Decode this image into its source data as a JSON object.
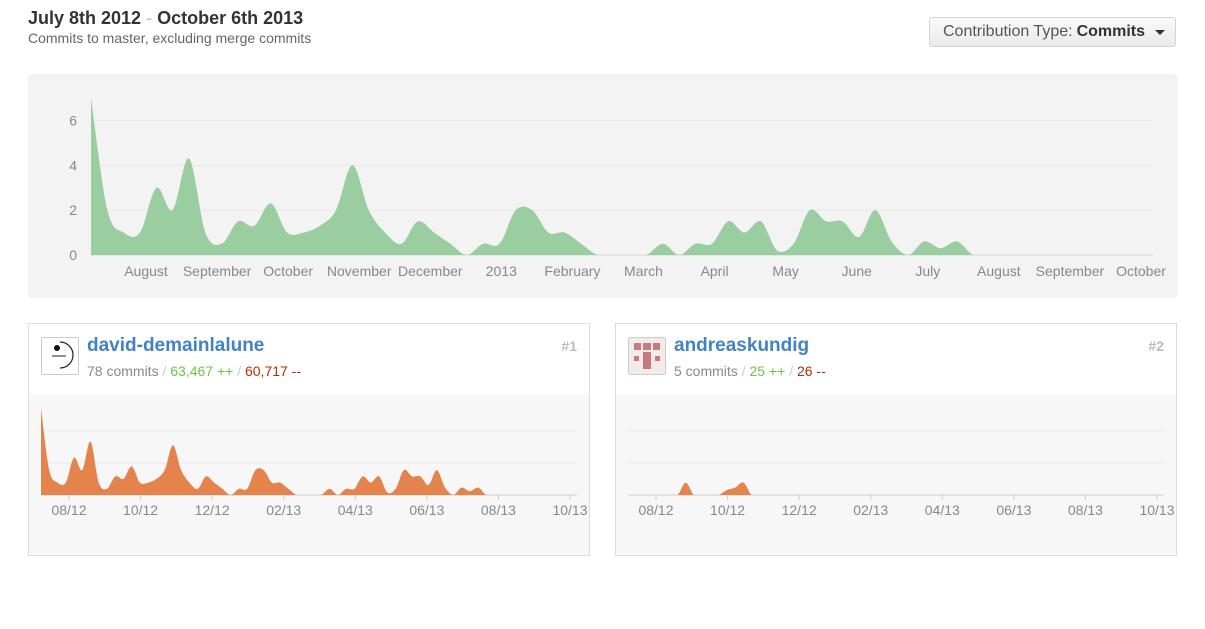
{
  "header": {
    "date_start": "July 8th 2012",
    "date_sep": "-",
    "date_end": "October 6th 2013",
    "subtitle": "Commits to master, excluding merge commits"
  },
  "contribution_type": {
    "label": "Contribution Type:",
    "value": "Commits"
  },
  "colors": {
    "main_area": "#9acd9f",
    "contributor_area": "#e4834b",
    "link": "#4183c4",
    "additions": "#6cc644",
    "deletions": "#bd2c00"
  },
  "chart_data": [
    {
      "type": "area",
      "ylim": [
        0,
        7
      ],
      "y_ticks": [
        "0",
        "2",
        "4",
        "6"
      ],
      "x_tick_labels": [
        "August",
        "September",
        "October",
        "November",
        "December",
        "2013",
        "February",
        "March",
        "April",
        "May",
        "June",
        "July",
        "August",
        "September",
        "October"
      ],
      "x": [
        "2012-07-08",
        "2012-07-15",
        "2012-07-22",
        "2012-07-29",
        "2012-08-05",
        "2012-08-12",
        "2012-08-19",
        "2012-08-26",
        "2012-09-02",
        "2012-09-09",
        "2012-09-16",
        "2012-09-23",
        "2012-09-30",
        "2012-10-07",
        "2012-10-14",
        "2012-10-21",
        "2012-10-28",
        "2012-11-04",
        "2012-11-11",
        "2012-11-18",
        "2012-11-25",
        "2012-12-02",
        "2012-12-09",
        "2012-12-16",
        "2012-12-23",
        "2012-12-30",
        "2013-01-06",
        "2013-01-13",
        "2013-01-20",
        "2013-01-27",
        "2013-02-03",
        "2013-02-10",
        "2013-02-17",
        "2013-02-24",
        "2013-03-03",
        "2013-03-10",
        "2013-03-17",
        "2013-03-24",
        "2013-03-31",
        "2013-04-07",
        "2013-04-14",
        "2013-04-21",
        "2013-04-28",
        "2013-05-05",
        "2013-05-12",
        "2013-05-19",
        "2013-05-26",
        "2013-06-02",
        "2013-06-09",
        "2013-06-16",
        "2013-06-23",
        "2013-06-30",
        "2013-07-07",
        "2013-07-14",
        "2013-07-21",
        "2013-07-28",
        "2013-08-04",
        "2013-08-11",
        "2013-08-18",
        "2013-08-25",
        "2013-09-01",
        "2013-09-08",
        "2013-09-15",
        "2013-09-22",
        "2013-09-29",
        "2013-10-06"
      ],
      "series": [
        {
          "values": [
            7,
            2,
            1,
            1,
            3,
            2,
            4.3,
            1,
            0.5,
            1.5,
            1.3,
            2.3,
            1,
            1,
            1.3,
            2,
            4,
            2,
            1,
            0.5,
            1.5,
            1,
            0.5,
            0,
            0.5,
            0.5,
            2,
            2,
            1,
            1,
            0.5,
            0,
            0,
            0,
            0,
            0.5,
            0,
            0.5,
            0.5,
            1.5,
            1,
            1.5,
            0.2,
            0.5,
            2,
            1.5,
            1.5,
            0.8,
            2,
            0.6,
            0,
            0.6,
            0.3,
            0.6,
            0,
            0,
            0,
            0,
            0,
            0,
            0,
            0,
            0,
            0,
            0,
            0
          ]
        }
      ]
    },
    {
      "type": "area",
      "x_tick_labels": [
        "08/12",
        "10/12",
        "12/12",
        "02/13",
        "04/13",
        "06/13",
        "08/13",
        "10/13"
      ],
      "series": [
        {
          "name": "david-demainlalune",
          "values": [
            7,
            2,
            1,
            1,
            3,
            2,
            4.3,
            1,
            0.5,
            1.5,
            1.3,
            2.3,
            1,
            1,
            1.3,
            2,
            4,
            2,
            1,
            0.5,
            1.5,
            1,
            0.5,
            0,
            0.5,
            0.5,
            2,
            2,
            1,
            1,
            0.5,
            0,
            0,
            0,
            0,
            0.5,
            0,
            0.5,
            0.5,
            1.5,
            1,
            1.5,
            0.2,
            0.5,
            2,
            1.5,
            1.5,
            0.8,
            2,
            0.6,
            0,
            0.6,
            0.3,
            0.6,
            0,
            0,
            0,
            0,
            0,
            0,
            0,
            0,
            0,
            0,
            0,
            0
          ]
        }
      ]
    },
    {
      "type": "area",
      "x_tick_labels": [
        "08/12",
        "10/12",
        "12/12",
        "02/13",
        "04/13",
        "06/13",
        "08/13",
        "10/13"
      ],
      "series": [
        {
          "name": "andreaskundig",
          "values": [
            0,
            0,
            0,
            0,
            0,
            0,
            0,
            1,
            0,
            0,
            0,
            0,
            0.4,
            0.6,
            1,
            0,
            0,
            0,
            0,
            0,
            0,
            0,
            0,
            0,
            0,
            0,
            0,
            0,
            0,
            0,
            0,
            0,
            0,
            0,
            0,
            0,
            0,
            0,
            0,
            0,
            0,
            0,
            0,
            0,
            0,
            0,
            0,
            0,
            0,
            0,
            0,
            0,
            0,
            0,
            0,
            0,
            0,
            0,
            0,
            0,
            0,
            0,
            0,
            0,
            0,
            0
          ]
        }
      ]
    }
  ],
  "contributors": [
    {
      "name": "david-demainlalune",
      "commits": "78 commits",
      "additions": "63,467 ++",
      "deletions": "60,717 --",
      "rank": "#1",
      "avatar_icon": "identicon-circle-icon"
    },
    {
      "name": "andreaskundig",
      "commits": "5 commits",
      "additions": "25 ++",
      "deletions": "26 --",
      "rank": "#2",
      "avatar_icon": "identicon-pink-blocks-icon"
    }
  ]
}
